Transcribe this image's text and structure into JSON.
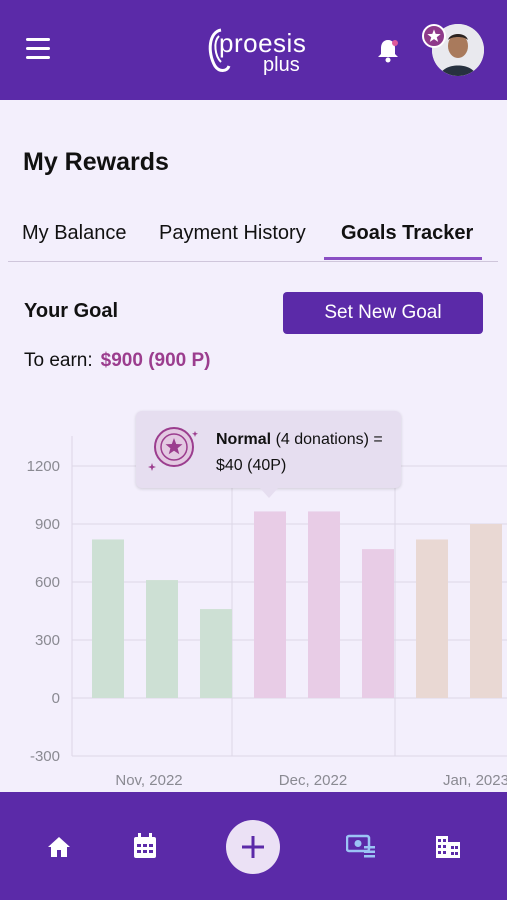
{
  "header": {
    "logo_word": "proesis",
    "logo_sub": "plus"
  },
  "page": {
    "title": "My Rewards",
    "tabs": [
      {
        "label": "My Balance",
        "active": false
      },
      {
        "label": "Payment History",
        "active": false
      },
      {
        "label": "Goals Tracker",
        "active": true
      }
    ]
  },
  "goal": {
    "label": "Your Goal",
    "set_button": "Set New Goal",
    "earn_label": "To earn:",
    "earn_value": "$900 (900 P)"
  },
  "tooltip": {
    "level": "Normal",
    "detail": " (4 donations) =",
    "amount": "$40 (40P)"
  },
  "colors": {
    "brand": "#5b2aa8",
    "accent": "#9b3d8e",
    "bar_nov": "#cde0d4",
    "bar_dec": "#e8cce6",
    "bar_jan": "#e9d8d3"
  },
  "chart_data": {
    "type": "bar",
    "categories": [
      "Nov, 2022",
      "Dec, 2022",
      "Jan, 2023"
    ],
    "values": [
      820,
      610,
      460,
      965,
      965,
      770,
      820,
      900
    ],
    "bar_groups": [
      0,
      0,
      0,
      1,
      1,
      1,
      2,
      2
    ],
    "yticks": [
      1200,
      900,
      600,
      300,
      0,
      -300
    ],
    "ylim": [
      -300,
      1200
    ],
    "grid": true
  },
  "bottom_nav": {
    "items": [
      "home-icon",
      "calendar-icon",
      "add-icon",
      "rewards-icon",
      "building-icon"
    ]
  }
}
